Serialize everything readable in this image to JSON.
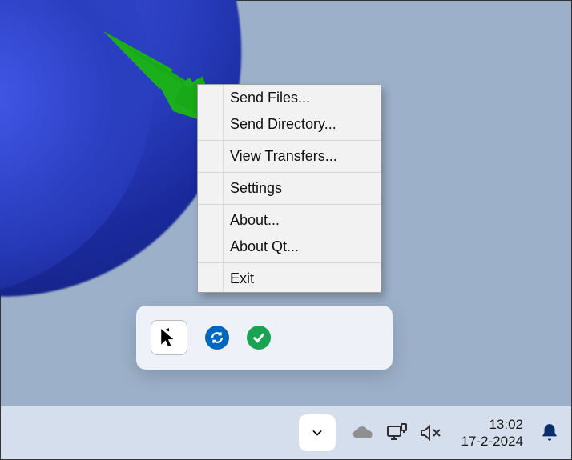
{
  "context_menu": {
    "items": [
      {
        "label": "Send Files...",
        "sep_after": false
      },
      {
        "label": "Send Directory...",
        "sep_after": true
      },
      {
        "label": "View Transfers...",
        "sep_after": true
      },
      {
        "label": "Settings",
        "sep_after": true
      },
      {
        "label": "About...",
        "sep_after": false
      },
      {
        "label": "About Qt...",
        "sep_after": true
      },
      {
        "label": "Exit",
        "sep_after": false
      }
    ]
  },
  "annotation": {
    "arrow_color": "#1BAF1B"
  },
  "tray_flyout": {
    "badges": [
      "update",
      "check"
    ]
  },
  "taskbar": {
    "time": "13:02",
    "date": "17-2-2024"
  }
}
